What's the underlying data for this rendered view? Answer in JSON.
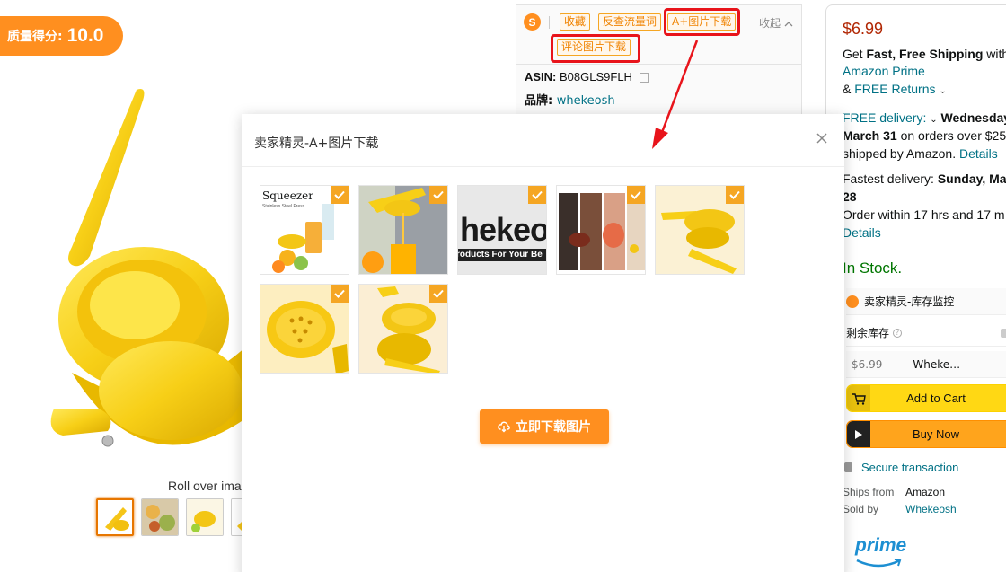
{
  "quality": {
    "label": "质量得分:",
    "score": "10.0"
  },
  "product": {
    "roll_over_text": "Roll over ima"
  },
  "plugin": {
    "logo": "S",
    "buttons": [
      "收藏",
      "反查流量词",
      "A+图片下载",
      "评论图片下载"
    ],
    "collapse_label": "收起",
    "asin_label": "ASIN:",
    "asin_value": "B08GLS9FLH",
    "brand_label": "品牌:",
    "brand_value": "whekeosh"
  },
  "modal": {
    "title": "卖家精灵-A+图片下载",
    "download_button": "立即下载图片",
    "image_texts": {
      "squeezer": "Squeezer",
      "squeezer_sub": "Stainless Steel Press",
      "brand_fragment": "hekeo",
      "brand_tagline": "roducts For Your Be"
    },
    "images_checked": [
      true,
      true,
      true,
      true,
      true,
      true,
      true
    ]
  },
  "buybox": {
    "price": "$6.99",
    "line1_pre": "Get ",
    "line1_bold": "Fast, Free Shipping",
    "line1_post": " with",
    "amazon_prime": "Amazon Prime",
    "free_returns_pre": "& ",
    "free_returns": "FREE Returns",
    "free_delivery": "FREE delivery:",
    "delivery_day": "Wednesday",
    "delivery_date": "March 31",
    "delivery_post": " on orders over $25",
    "shipped_by": "shipped by Amazon. ",
    "details": "Details",
    "fastest_label": "Fastest delivery: ",
    "fastest_day": "Sunday, Ma",
    "fastest_date": "28",
    "order_within": "Order within 17 hrs and 17 m",
    "details2": "Details",
    "in_stock": "In Stock.",
    "inventory_plugin_title": "卖家精灵-库存监控",
    "remaining_stock": "剩余库存",
    "row_price": "$6.99",
    "row_seller": "Wheke…",
    "add_to_cart": "Add to Cart",
    "buy_now": "Buy Now",
    "secure_transaction": "Secure transaction",
    "ships_from_label": "Ships from",
    "ships_from_value": "Amazon",
    "sold_by_label": "Sold by",
    "sold_by_value": "Whekeosh",
    "prime": "prime"
  },
  "colors": {
    "accent": "#ff8f1f",
    "check": "#f5a623",
    "highlight": "#e8141b",
    "link": "#007185",
    "price": "#b12704",
    "stock": "#007600"
  }
}
